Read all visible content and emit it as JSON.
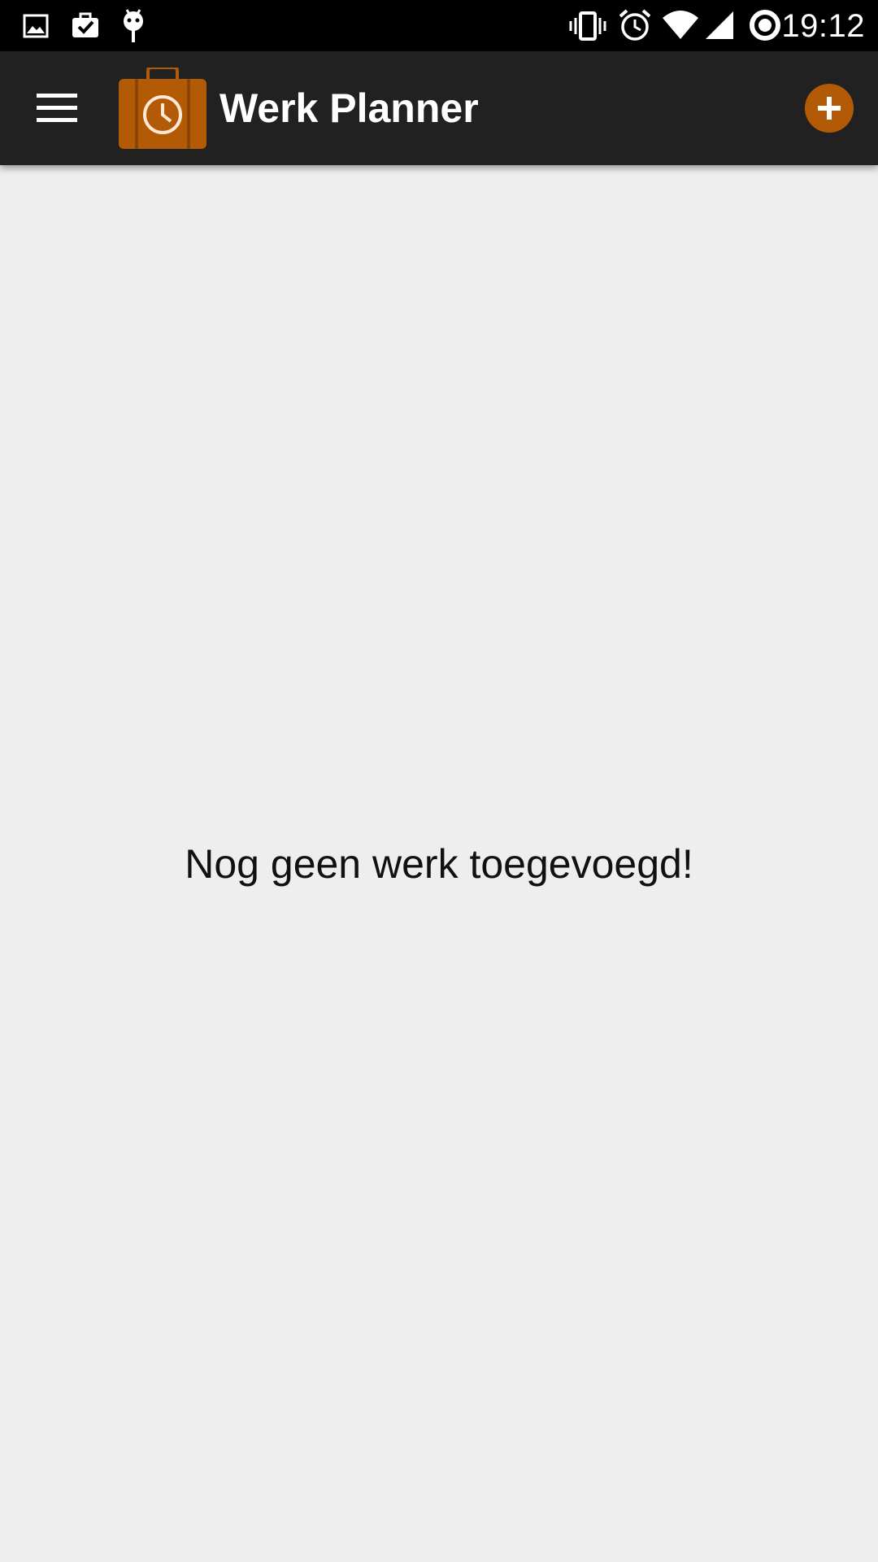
{
  "status_bar": {
    "time": "19:12",
    "left_icons": [
      "image-icon",
      "briefcase-check-icon",
      "android-icon"
    ],
    "right_icons": [
      "vibrate-icon",
      "alarm-icon",
      "wifi-icon",
      "signal-icon",
      "sync-icon"
    ]
  },
  "toolbar": {
    "title": "Werk Planner",
    "menu_icon": "hamburger-menu-icon",
    "logo_icon": "briefcase-clock-icon",
    "add_icon": "plus-icon",
    "accent_color": "#b35a06",
    "background_color": "#212121"
  },
  "main": {
    "empty_message": "Nog geen werk toegevoegd!",
    "background_color": "#eeeeee"
  }
}
